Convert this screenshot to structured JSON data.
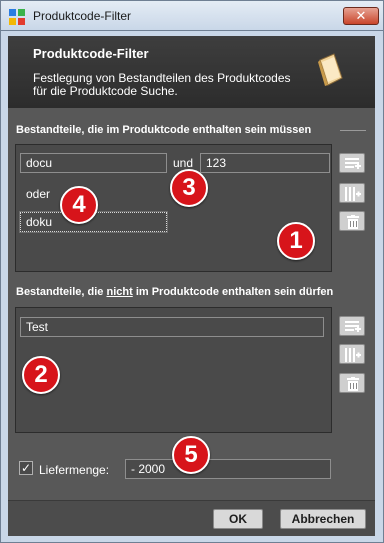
{
  "window": {
    "title": "Produktcode-Filter",
    "close_symbol": "✕"
  },
  "header": {
    "title": "Produktcode-Filter",
    "description": "Festlegung von Bestandteilen des Produktcodes für die Produktcode Suche."
  },
  "include_section": {
    "label": "Bestandteile, die im Produktcode enthalten sein müssen",
    "row1": {
      "value1": "docu",
      "connector": "und",
      "value2": "123"
    },
    "or_label": "oder",
    "row2": {
      "value1": "doku"
    }
  },
  "exclude_section": {
    "label_before": "Bestandteile, die ",
    "label_emph": "nicht",
    "label_after": " im Produktcode enthalten sein dürfen",
    "row1": {
      "value1": "Test"
    }
  },
  "delivery": {
    "checked": true,
    "check_mark": "✓",
    "label": "Liefermenge:",
    "value": "- 2000"
  },
  "buttons": {
    "ok": "OK",
    "cancel": "Abbrechen"
  },
  "badges": [
    "1",
    "2",
    "3",
    "4",
    "5"
  ],
  "colors": {
    "badge": "#d7141a",
    "header_bg": "#333333",
    "content_bg": "#585858"
  }
}
